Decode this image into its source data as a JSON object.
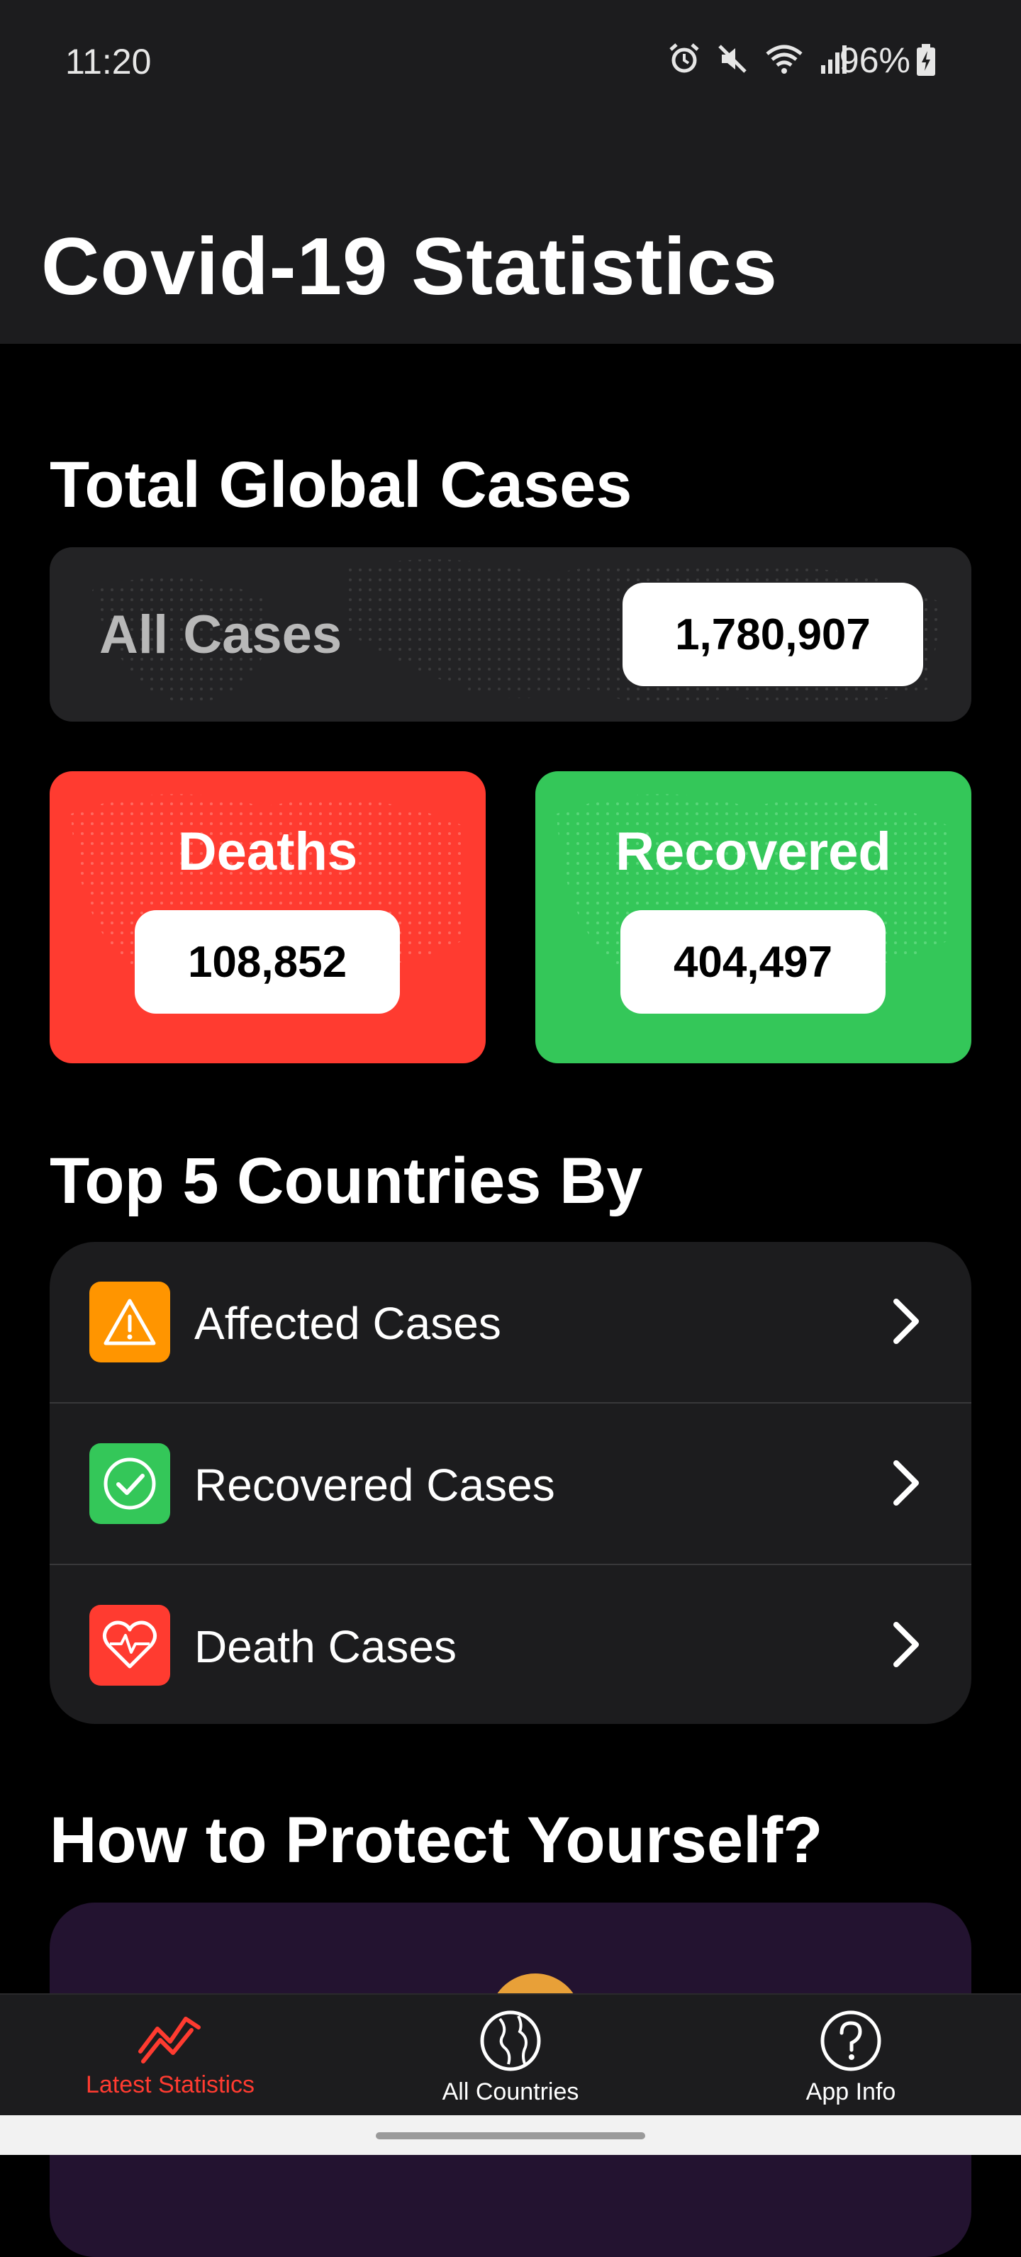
{
  "status_bar": {
    "time": "11:20",
    "battery": "96%",
    "icons": [
      "alarm-icon",
      "mute-icon",
      "wifi-icon",
      "signal-icon",
      "battery-charging-icon"
    ]
  },
  "header": {
    "title": "Covid-19 Statistics"
  },
  "global": {
    "section_title": "Total Global Cases",
    "all_cases_label": "All Cases",
    "all_cases_value": "1,780,907",
    "deaths_label": "Deaths",
    "deaths_value": "108,852",
    "recovered_label": "Recovered",
    "recovered_value": "404,497"
  },
  "top5": {
    "section_title": "Top 5 Countries By",
    "items": [
      {
        "label": "Affected Cases",
        "icon": "warning-icon",
        "color": "#ff9500"
      },
      {
        "label": "Recovered Cases",
        "icon": "check-circle-icon",
        "color": "#34c759"
      },
      {
        "label": "Death Cases",
        "icon": "heart-pulse-icon",
        "color": "#ff3b30"
      }
    ]
  },
  "protect": {
    "section_title": "How to Protect Yourself?"
  },
  "tabs": [
    {
      "label": "Latest Statistics",
      "icon": "chart-line-icon",
      "active": true
    },
    {
      "label": "All Countries",
      "icon": "globe-icon",
      "active": false
    },
    {
      "label": "App Info",
      "icon": "question-icon",
      "active": false
    }
  ],
  "colors": {
    "red": "#ff3b30",
    "green": "#34c759",
    "orange": "#ff9500",
    "card_dark": "#1c1c1e"
  }
}
